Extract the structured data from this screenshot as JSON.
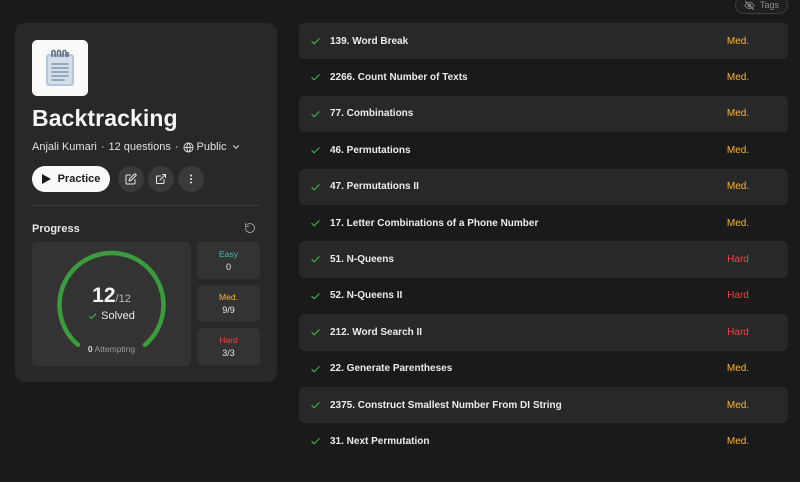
{
  "colors": {
    "easy": "#4bb8b8",
    "medium": "#ffb52e",
    "hard": "#ec4545",
    "solved_ring": "#3c9b3c",
    "check": "#3bb14a"
  },
  "tags_button": {
    "label": "Tags",
    "icon": "eye-off-icon"
  },
  "list": {
    "title": "Backtracking",
    "author": "Anjali Kumari",
    "question_count": "12 questions",
    "visibility": "Public",
    "cover_icon": "notepad-icon"
  },
  "actions": {
    "practice_label": "Practice",
    "edit_icon": "edit-icon",
    "share_icon": "external-link-icon",
    "more_icon": "more-vertical-icon"
  },
  "progress": {
    "label": "Progress",
    "solved": "12",
    "total": "/12",
    "solved_label": "Solved",
    "attempting_count": "0",
    "attempting_label": "Attempting",
    "solved_fraction": 1.0,
    "easy": {
      "label": "Easy",
      "value": "0"
    },
    "medium": {
      "label": "Med.",
      "value": "9/9"
    },
    "hard": {
      "label": "Hard",
      "value": "3/3"
    }
  },
  "questions": [
    {
      "title": "139. Word Break",
      "difficulty": "Med.",
      "level": "medium"
    },
    {
      "title": "2266. Count Number of Texts",
      "difficulty": "Med.",
      "level": "medium"
    },
    {
      "title": "77. Combinations",
      "difficulty": "Med.",
      "level": "medium"
    },
    {
      "title": "46. Permutations",
      "difficulty": "Med.",
      "level": "medium"
    },
    {
      "title": "47. Permutations II",
      "difficulty": "Med.",
      "level": "medium"
    },
    {
      "title": "17. Letter Combinations of a Phone Number",
      "difficulty": "Med.",
      "level": "medium"
    },
    {
      "title": "51. N-Queens",
      "difficulty": "Hard",
      "level": "hard"
    },
    {
      "title": "52. N-Queens II",
      "difficulty": "Hard",
      "level": "hard"
    },
    {
      "title": "212. Word Search II",
      "difficulty": "Hard",
      "level": "hard"
    },
    {
      "title": "22. Generate Parentheses",
      "difficulty": "Med.",
      "level": "medium"
    },
    {
      "title": "2375. Construct Smallest Number From DI String",
      "difficulty": "Med.",
      "level": "medium"
    },
    {
      "title": "31. Next Permutation",
      "difficulty": "Med.",
      "level": "medium"
    }
  ]
}
